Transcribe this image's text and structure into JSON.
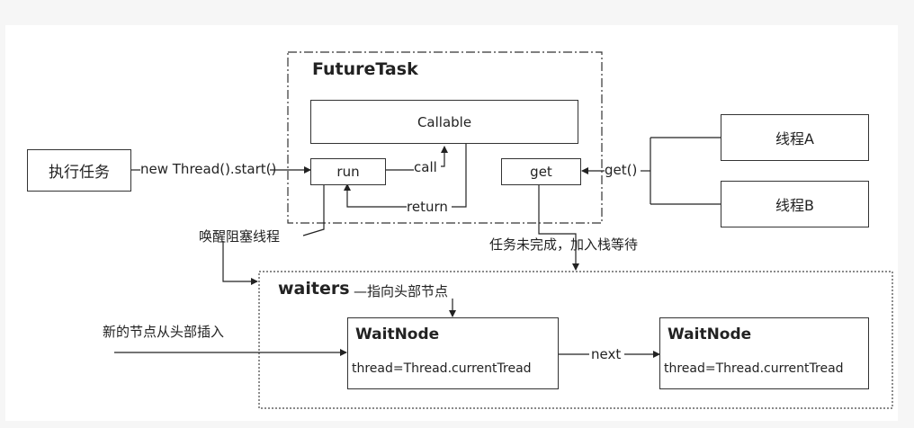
{
  "futuretask": {
    "title": "FutureTask",
    "callable": "Callable",
    "run": "run",
    "get": "get"
  },
  "execute_task": "执行任务",
  "threads": {
    "a": "线程A",
    "b": "线程B"
  },
  "edges": {
    "new_thread": "new Thread().start()",
    "call": "call",
    "return": "return",
    "get_call": "get()",
    "wake": "唤醒阻塞线程",
    "not_done": "任务未完成，加入栈等待",
    "next": "next",
    "insert_head": "新的节点从头部插入"
  },
  "waiters": {
    "title": "waiters",
    "pointer": "指向头部节点"
  },
  "wait_nodes": [
    {
      "title": "WaitNode",
      "thread": "thread=Thread.currentTread"
    },
    {
      "title": "WaitNode",
      "thread": "thread=Thread.currentTread"
    }
  ]
}
